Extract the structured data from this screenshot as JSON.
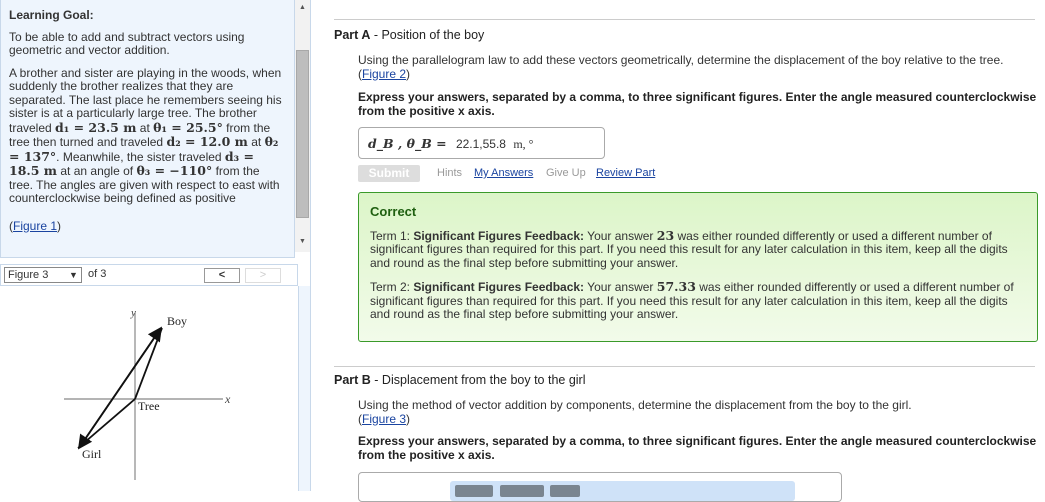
{
  "goal": {
    "title": "Learning Goal:",
    "intro": "To be able to add and subtract vectors using geometric and vector addition.",
    "p1": "A brother and sister are playing in the woods, when suddenly the brother realizes that they are separated. The last place he remembers seeing his sister is at a particularly large tree. The brother traveled ",
    "d1": "d₁ = 23.5 m",
    "at1": " at ",
    "th1": "θ₁ = 25.5°",
    "p2": " from the tree then turned and traveled ",
    "d2": "d₂ = 12.0 m",
    "at2": " at ",
    "th2": "θ₂ = 137°",
    "p3": ". Meanwhile, the sister traveled ",
    "d3": "d₃ = 18.5 m",
    "p4": " at an angle of ",
    "th3": "θ₃ = −110°",
    "p5": " from the tree. The angles are given with respect to east with counterclockwise being defined as positive",
    "fig_link": "Figure 1"
  },
  "figure": {
    "selected": "Figure 3",
    "of": "of 3",
    "prev": "<",
    "next": ">",
    "labels": {
      "y": "y",
      "x": "x",
      "boy": "Boy",
      "tree": "Tree",
      "girl": "Girl"
    }
  },
  "partA": {
    "label": "Part A",
    "title": " - Position of the boy",
    "question": "Using the parallelogram law to add these vectors geometrically, determine the displacement of the boy relative to the tree.",
    "fig_link": "Figure 2",
    "instruction": "Express your answers, separated by a comma, to three significant figures. Enter the angle measured counterclockwise from the positive x axis.",
    "answer_label": "d_B , θ_B =",
    "answer_value": "22.1,55.8",
    "answer_units": "m, °",
    "submit": "Submit",
    "hints": "Hints",
    "my_answers": "My Answers",
    "give_up": "Give Up",
    "review": "Review Part",
    "feedback": {
      "title": "Correct",
      "terms": [
        {
          "prefix": "Term 1: ",
          "head": "Significant Figures Feedback:",
          "pre": " Your answer ",
          "value": "23",
          "text": " was either rounded differently or used a different number of significant figures than required for this part. If you need this result for any later calculation in this item, keep all the digits and round as the final step before submitting your answer."
        },
        {
          "prefix": "Term 2: ",
          "head": "Significant Figures Feedback:",
          "pre": " Your answer ",
          "value": "57.33",
          "text": " was either rounded differently or used a different number of significant figures than required for this part. If you need this result for any later calculation in this item, keep all the digits and round as the final step before submitting your answer."
        }
      ]
    }
  },
  "partB": {
    "label": "Part B",
    "title": " - Displacement from the boy to the girl",
    "question": "Using the method of vector addition by components, determine the displacement from the boy to the girl.",
    "fig_link": "Figure 3",
    "instruction": "Express your answers, separated by a comma, to three significant figures. Enter the angle measured counterclockwise from the positive x axis."
  }
}
